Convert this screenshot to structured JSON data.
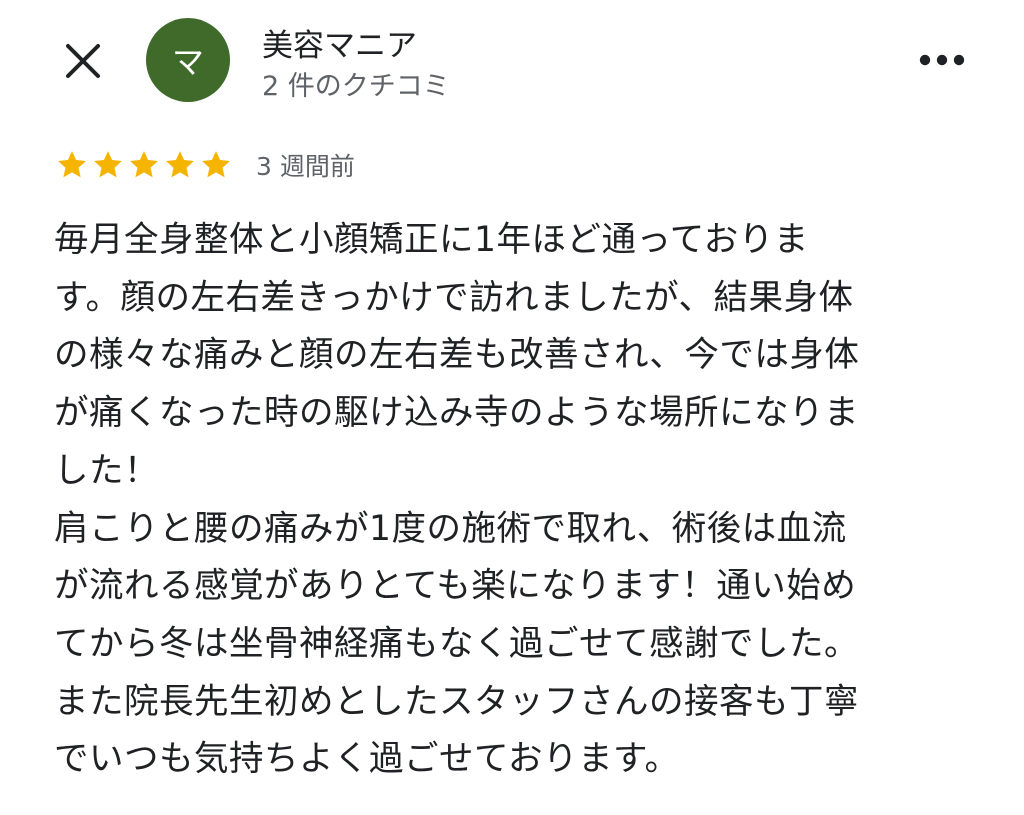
{
  "header": {
    "avatar_initial": "マ",
    "avatar_color": "#3f6a2a",
    "author_name": "美容マニア",
    "author_meta": "2 件のクチコミ",
    "close_icon": "close-icon",
    "more_icon": "more-horizontal-icon"
  },
  "review": {
    "rating": 5,
    "rating_max": 5,
    "star_color": "#f4b400",
    "date": "3 週間前",
    "body": "毎月全身整体と小顔矯正に1年ほど通っておりま\nす。顔の左右差きっかけで訪れましたが、結果身体\nの様々な痛みと顔の左右差も改善され、今では身体\nが痛くなった時の駆け込み寺のような場所になりま\nした！\n肩こりと腰の痛みが1度の施術で取れ、術後は血流\nが流れる感覚がありとても楽になります！通い始め\nてから冬は坐骨神経痛もなく過ごせて感謝でした。\nまた院長先生初めとしたスタッフさんの接客も丁寧\nでいつも気持ちよく過ごせております。"
  }
}
